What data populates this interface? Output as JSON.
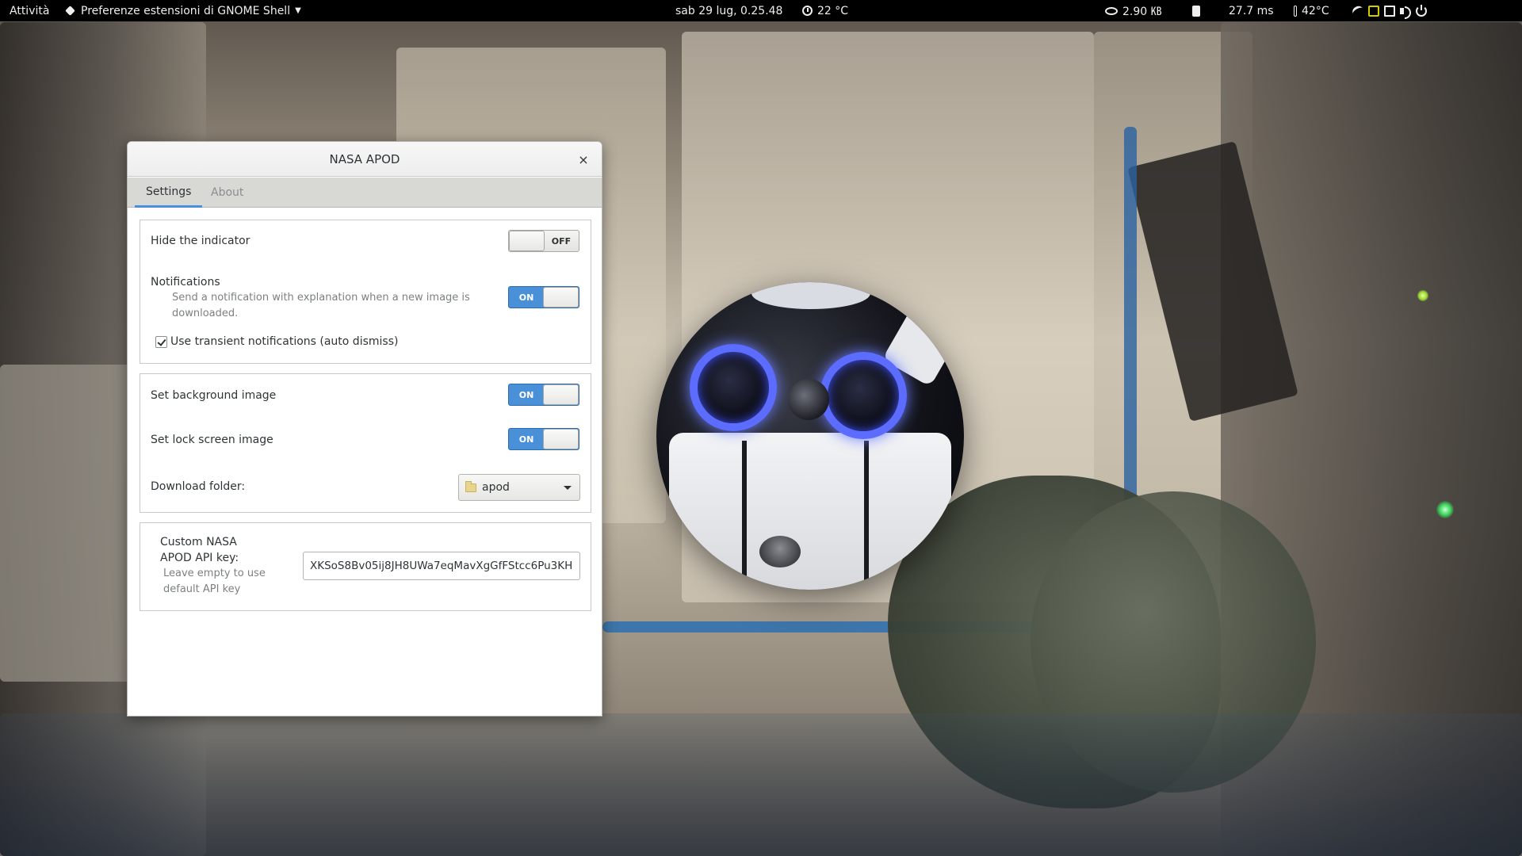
{
  "topbar": {
    "activities": "Attività",
    "app_menu": "Preferenze estensioni di GNOME Shell",
    "clock": "sab 29 lug,  0.25.48",
    "weather": "22 °C",
    "net_speed": "2.90 ㎅",
    "ping": "27.7 ms",
    "cpu_temp": "42°C"
  },
  "window": {
    "title": "NASA APOD",
    "close_symbol": "×",
    "tabs": [
      {
        "label": "Settings",
        "active": true
      },
      {
        "label": "About",
        "active": false
      }
    ]
  },
  "settings": {
    "hide_indicator": {
      "label": "Hide the indicator",
      "state": "OFF"
    },
    "notifications": {
      "label": "Notifications",
      "description": "Send a notification with explanation when a new image is downloaded.",
      "state": "ON"
    },
    "transient": {
      "label": "Use transient notifications (auto dismiss)",
      "checked": true
    },
    "background": {
      "label": "Set background image",
      "state": "ON"
    },
    "lock_screen": {
      "label": "Set lock screen image",
      "state": "ON"
    },
    "download_folder": {
      "label": "Download folder:",
      "value": "apod"
    },
    "api_key": {
      "label": "Custom NASA APOD API key:",
      "hint": "Leave empty to use default API key",
      "value": "XKSoS8Bv05ij8JH8UWa7eqMavXgGfFStcc6Pu3KH"
    }
  },
  "colors": {
    "accent": "#4a90d9",
    "topbar_bg": "#000000"
  },
  "icons": [
    "puzzle-icon",
    "clock-icon",
    "eye-icon",
    "battery-icon",
    "thermometer-icon",
    "square-icon",
    "wifi-icon",
    "network-icon",
    "volume-icon",
    "power-icon",
    "folder-icon",
    "chevron-down-icon",
    "checkmark-icon"
  ]
}
